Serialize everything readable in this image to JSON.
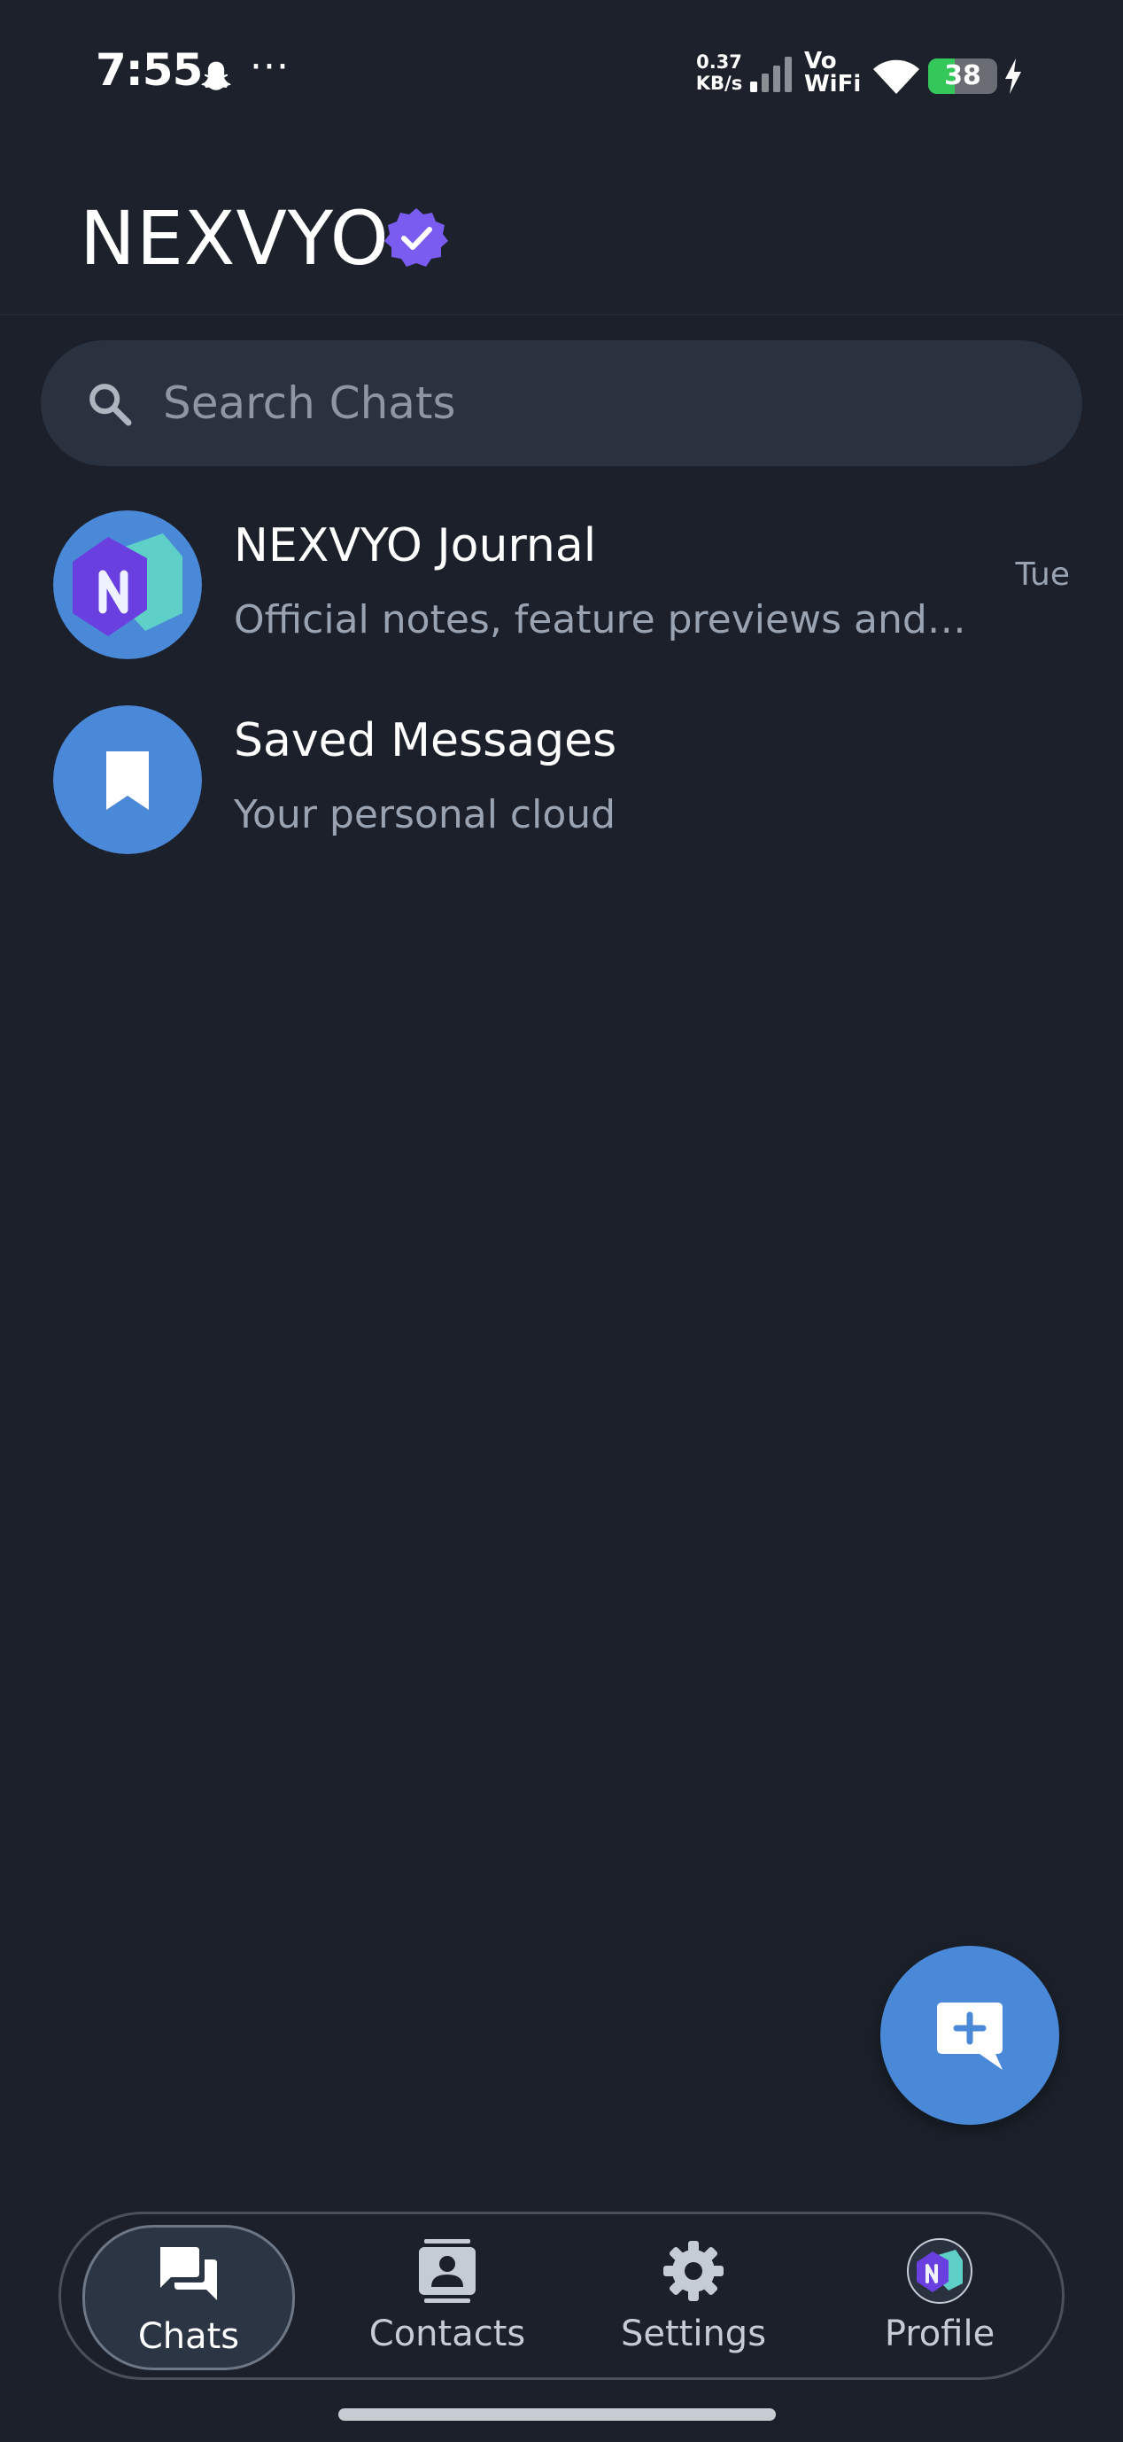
{
  "status_bar": {
    "time": "7:55",
    "more": "···",
    "net_speed_value": "0.37",
    "net_speed_unit": "KB/s",
    "vowifi_top": "Vo",
    "vowifi_bottom": "WiFi",
    "battery_level": "38",
    "battery_fraction": 0.38
  },
  "header": {
    "title": "NEXVYO",
    "verified_icon": "verified-badge-icon",
    "verified_color": "#7b5cf0"
  },
  "search": {
    "placeholder": "Search Chats"
  },
  "chats": [
    {
      "name": "NEXVYO Journal",
      "preview": "Official notes, feature previews and product updates",
      "time": "Tue",
      "avatar": "nexvyo-logo-icon"
    },
    {
      "name": "Saved Messages",
      "preview": "Your personal cloud",
      "time": "",
      "avatar": "bookmark-icon"
    }
  ],
  "fab": {
    "icon": "new-chat-icon"
  },
  "nav": {
    "items": [
      {
        "label": "Chats",
        "icon": "chats-icon",
        "active": true
      },
      {
        "label": "Contacts",
        "icon": "contacts-icon",
        "active": false
      },
      {
        "label": "Settings",
        "icon": "gear-icon",
        "active": false
      },
      {
        "label": "Profile",
        "icon": "profile-avatar-icon",
        "active": false
      }
    ]
  },
  "colors": {
    "background": "#1b202a",
    "accent_blue": "#4a88d8",
    "brand_purple": "#7b5cf0",
    "brand_teal": "#5fd0c8",
    "search_bg": "#2a3240",
    "secondary_text": "#9aa3b1"
  }
}
